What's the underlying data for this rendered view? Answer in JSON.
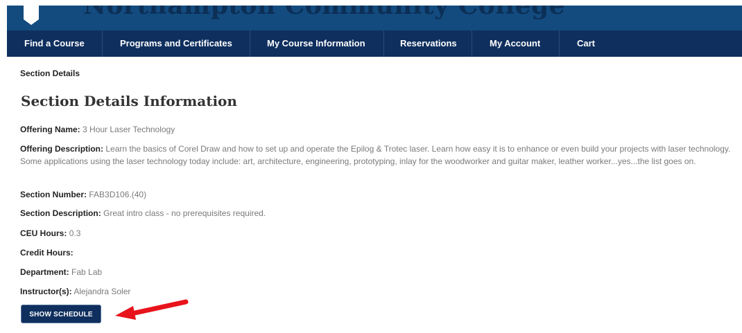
{
  "banner": {
    "title": "Northampton Community College",
    "bg_color": "#134b7f"
  },
  "nav": {
    "bg_color": "#0f2f5e",
    "items": [
      {
        "label": "Find a Course"
      },
      {
        "label": "Programs and Certificates"
      },
      {
        "label": "My Course Information"
      },
      {
        "label": "Reservations"
      },
      {
        "label": "My Account"
      },
      {
        "label": "Cart"
      }
    ]
  },
  "breadcrumb": "Section Details",
  "page_title": "Section Details Information",
  "details": {
    "offering_name": {
      "label": "Offering Name:",
      "value": "3 Hour Laser Technology"
    },
    "offering_description": {
      "label": "Offering Description:",
      "value": "Learn the basics of Corel Draw and how to set up and operate the Epilog & Trotec laser. Learn how easy it is to enhance or even build your projects with laser technology. Some applications using the laser technology today include: art, architecture, engineering, prototyping, inlay for the woodworker and guitar maker, leather worker...yes...the list goes on."
    },
    "section_number": {
      "label": "Section Number:",
      "value": "FAB3D106.(40)"
    },
    "section_description": {
      "label": "Section Description:",
      "value": "Great intro class - no prerequisites required."
    },
    "ceu_hours": {
      "label": "CEU Hours:",
      "value": "0.3"
    },
    "credit_hours": {
      "label": "Credit Hours:",
      "value": ""
    },
    "department": {
      "label": "Department:",
      "value": "Fab Lab"
    },
    "instructors": {
      "label": "Instructor(s):",
      "value": "Alejandra Soler"
    }
  },
  "show_schedule_label": "SHOW SCHEDULE",
  "annotation": {
    "arrow_color": "#e8141b",
    "icon": "arrow-left-icon"
  }
}
